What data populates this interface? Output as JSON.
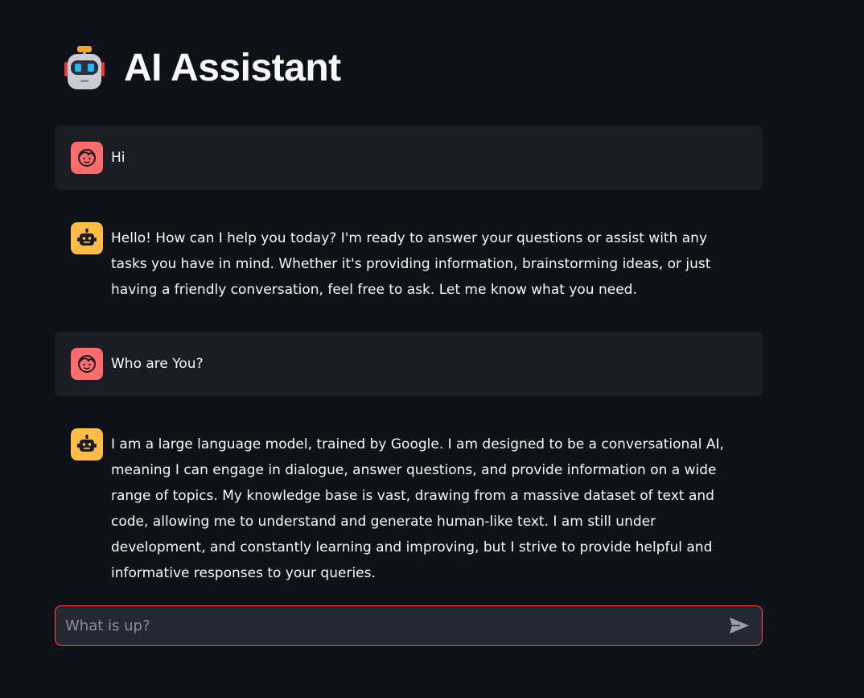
{
  "header": {
    "title": "AI Assistant",
    "emoji_icon": "robot-face-icon"
  },
  "messages": [
    {
      "role": "user",
      "avatar_icon": "user-face-icon",
      "text": "Hi"
    },
    {
      "role": "assistant",
      "avatar_icon": "robot-icon",
      "text": "Hello! How can I help you today? I'm ready to answer your questions or assist with any tasks you have in mind. Whether it's providing information, brainstorming ideas, or just having a friendly conversation, feel free to ask. Let me know what you need."
    },
    {
      "role": "user",
      "avatar_icon": "user-face-icon",
      "text": "Who are You?"
    },
    {
      "role": "assistant",
      "avatar_icon": "robot-icon",
      "text": "I am a large language model, trained by Google. I am designed to be a conversational AI, meaning I can engage in dialogue, answer questions, and provide information on a wide range of topics. My knowledge base is vast, drawing from a massive dataset of text and code, allowing me to understand and generate human-like text. I am still under development, and constantly learning and improving, but I strive to provide helpful and informative responses to your queries."
    }
  ],
  "chat_input": {
    "placeholder": "What is up?",
    "value": "",
    "send_icon": "send-icon"
  },
  "colors": {
    "background": "#0e1117",
    "user_bubble": "#1a1c24",
    "user_avatar": "#ff6c6c",
    "assistant_avatar": "#ffbd45",
    "input_border": "#ff4b4b",
    "input_background": "#262730"
  }
}
